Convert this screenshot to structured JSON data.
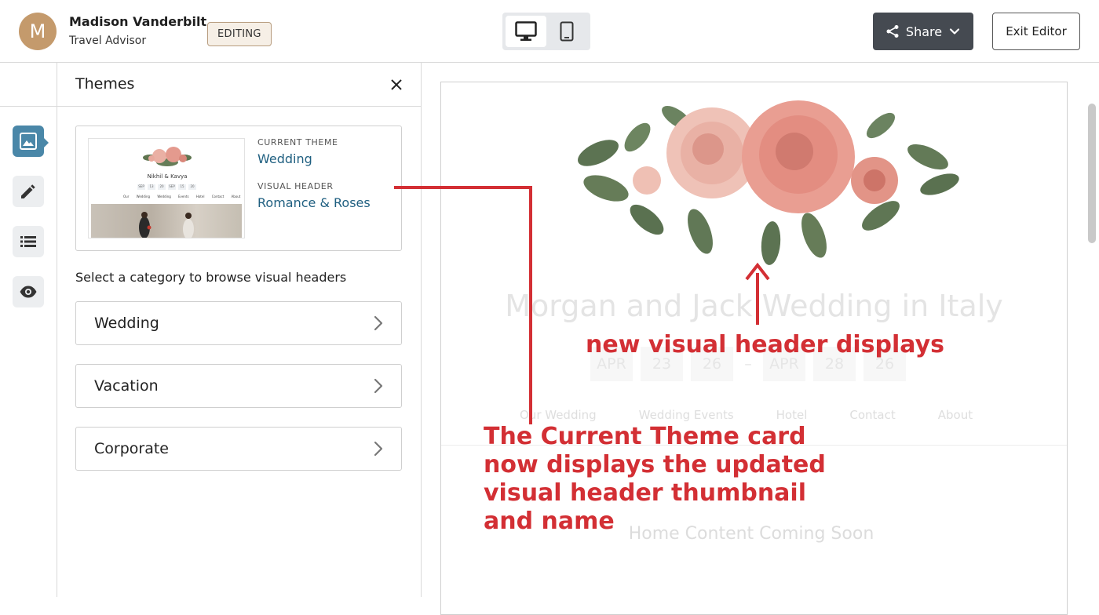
{
  "header": {
    "avatar_initial": "M",
    "user_name": "Madison Vanderbilt",
    "user_role": "Travel Advisor",
    "editing_badge": "EDITING",
    "share_label": "Share",
    "exit_label": "Exit Editor"
  },
  "themes_panel": {
    "title": "Themes",
    "current_theme_label": "CURRENT THEME",
    "current_theme_value": "Wedding",
    "visual_header_label": "VISUAL HEADER",
    "visual_header_value": "Romance & Roses",
    "thumbnail": {
      "names": "Nikhil & Kavya",
      "dates": [
        "SEP",
        "13",
        "20",
        "SEP",
        "15",
        "20"
      ],
      "nav": "Our Wedding  Wedding Events  Hotel  Contact  About"
    },
    "browse_label": "Select a category to browse visual headers",
    "categories": [
      "Wedding",
      "Vacation",
      "Corporate"
    ]
  },
  "preview": {
    "site_title": "Morgan and Jack Wedding in Italy",
    "dates": [
      "APR",
      "23",
      "26",
      "APR",
      "28",
      "26"
    ],
    "nav": [
      "Our Wedding",
      "Wedding Events",
      "Hotel",
      "Contact",
      "About"
    ],
    "coming_soon": "Home Content Coming Soon"
  },
  "annotations": {
    "header_note": "new visual header displays",
    "card_note_1": "The Current Theme card",
    "card_note_2": "now displays the updated",
    "card_note_3": "visual header thumbnail",
    "card_note_4": "and name"
  },
  "colors": {
    "accent": "#4a87a8",
    "link": "#1f5f80",
    "annotation": "#d32f34",
    "share_bg": "#454a51"
  }
}
